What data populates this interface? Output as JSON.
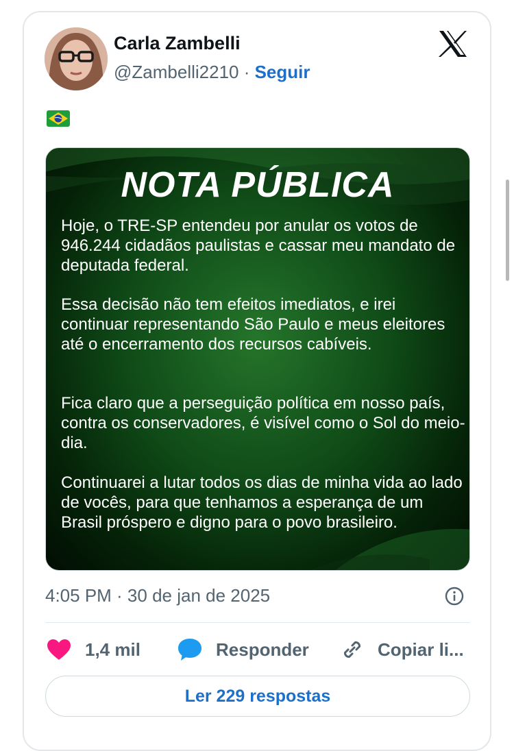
{
  "tweet": {
    "author_name": "Carla Zambelli",
    "handle": "@Zambelli2210",
    "separator": " · ",
    "follow_label": "Seguir",
    "timestamp": "4:05 PM · 30 de jan de 2025"
  },
  "media": {
    "title": "NOTA PÚBLICA",
    "paragraphs": [
      "Hoje, o TRE-SP entendeu por anular os votos de 946.244 cidadãos paulistas e cassar meu mandato de deputada federal.",
      "Essa decisão não tem efeitos imediatos, e irei continuar representando São Paulo e meus eleitores até o encerramento dos recursos cabíveis.",
      "Fica claro que a perseguição política em nosso país, contra os conservadores, é visível como o Sol do meio-dia.",
      "Continuarei a lutar todos os dias de minha vida ao lado de vocês, para que tenhamos a esperança de um Brasil próspero e digno para o povo brasileiro."
    ]
  },
  "actions": {
    "like_count": "1,4 mil",
    "reply_label": "Responder",
    "copy_label": "Copiar li..."
  },
  "read_replies_label": "Ler 229 respostas",
  "icons": {
    "logo": "x-logo-icon",
    "flag": "brazil-flag-icon",
    "info": "info-icon",
    "like": "heart-icon",
    "reply": "speech-bubble-icon",
    "copy": "link-icon"
  },
  "colors": {
    "accent": "#1d6fc9",
    "like": "#f91880",
    "reply": "#1d9bf0",
    "muted": "#536471"
  }
}
